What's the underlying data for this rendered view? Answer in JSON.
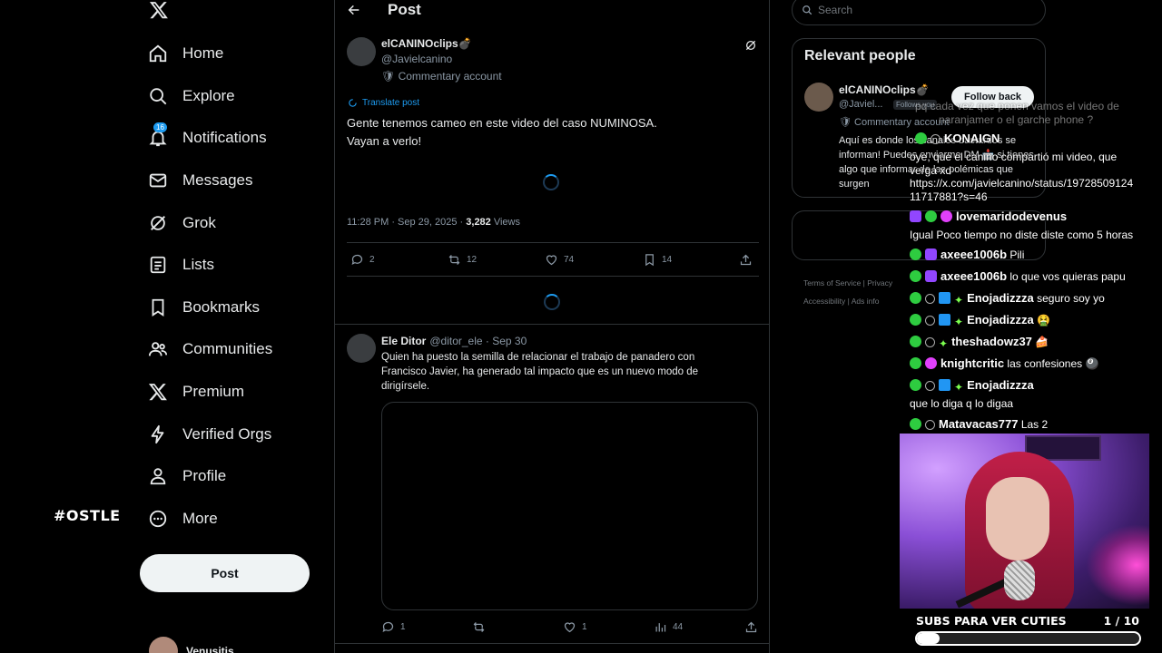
{
  "overlay": {
    "brand_tag": "#OSTLE"
  },
  "nav": {
    "items": [
      {
        "label": "Home"
      },
      {
        "label": "Explore"
      },
      {
        "label": "Notifications",
        "badge": "16"
      },
      {
        "label": "Messages"
      },
      {
        "label": "Grok"
      },
      {
        "label": "Lists"
      },
      {
        "label": "Bookmarks"
      },
      {
        "label": "Communities"
      },
      {
        "label": "Premium"
      },
      {
        "label": "Verified Orgs"
      },
      {
        "label": "Profile"
      },
      {
        "label": "More"
      }
    ],
    "post_button": "Post",
    "account_name": "Venusitis"
  },
  "header": {
    "title": "Post"
  },
  "main_post": {
    "name": "elCANINOclips💣",
    "handle": "@Javielcanino",
    "role": "🛡 Commentary account",
    "translate": "Translate post",
    "text_line1": "Gente tenemos cameo en este video del caso NUMINOSA.",
    "text_line2": "Vayan a verlo!",
    "time": "11:28 PM · Sep 29, 2025 · ",
    "views_count": "3,282",
    "views_label": " Views",
    "replies": "2",
    "reposts": "12",
    "likes": "74",
    "bookmarks": "14"
  },
  "reply": {
    "name": "Ele Ditor",
    "handle_date": "@ditor_ele · Sep 30",
    "text": "Quien ha puesto la semilla de relacionar el trabajo de panadero con Francisco Javier, ha generado tal impacto que es un nuevo modo de dirigírsele.",
    "replies": "1",
    "likes": "1",
    "views": "44"
  },
  "search": {
    "placeholder": "Search"
  },
  "relevant": {
    "title": "Relevant people",
    "name": "elCANINOclips💣",
    "handle": "@Javiel...",
    "follows_you": "Follows you",
    "role": "🛡 Commentary account",
    "bio": "Aquí es donde los canales bastardos se informan! Puedes enviarme DM 📩 si tienes algo que informar de las polémicas que surgen",
    "follow_button": "Follow back"
  },
  "footer": {
    "line1": "Terms of Service  |  Privacy",
    "line2": "Accessibility  |  Ads info"
  },
  "chat": {
    "ghost1": "pq cada vez que ponen vamos el video de",
    "ghost2": "naranjamer o el garche phone ?",
    "m1_user": "KONAIGN",
    "m1_text": "oye, que el canino compartió mi video, que",
    "m1_text2": "verga xd",
    "m1_link1": "https://x.com/javielcanino/status/19728509124",
    "m1_link2": "11717881?s=46",
    "m2_user": "lovemaridodevenus",
    "m2_text": "Igual Poco tiempo no diste diste como 5 horas",
    "m3_user": "axeee1006b",
    "m3_text": "Pili",
    "m4_user": "axeee1006b",
    "m4_text": "lo que vos quieras papu",
    "m5_user": "Enojadizzza",
    "m5_text": "seguro soy yo",
    "m6_user": "Enojadizzza",
    "m6_text": "🤮",
    "m7_user": "theshadowz37",
    "m7_text": "🍰",
    "m8_user": "knightcritic",
    "m8_text": "las confesiones 🎱",
    "m9_user": "Enojadizzza",
    "m9_text": "que lo diga q lo digaa",
    "m10_user": "Matavacas777",
    "m10_text": "Las 2"
  },
  "subs": {
    "label": "SUBS PARA VER CUTIES",
    "count": "1  / 10",
    "progress": 0.1
  }
}
